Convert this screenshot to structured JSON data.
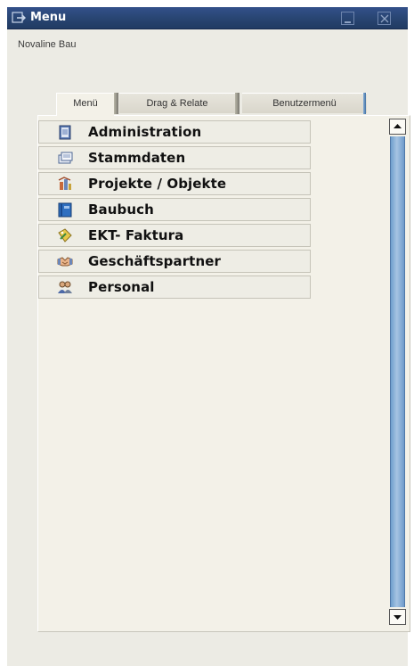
{
  "window": {
    "title": "Menu",
    "company": "Novaline Bau"
  },
  "tabs": [
    {
      "label": "Menü",
      "active": true
    },
    {
      "label": "Drag & Relate",
      "active": false
    },
    {
      "label": "Benutzermenü",
      "active": false
    }
  ],
  "menu": {
    "items": [
      {
        "label": "Administration",
        "icon": "administration-icon"
      },
      {
        "label": "Stammdaten",
        "icon": "stammdaten-icon"
      },
      {
        "label": "Projekte / Objekte",
        "icon": "projekte-icon"
      },
      {
        "label": "Baubuch",
        "icon": "baubuch-icon"
      },
      {
        "label": "EKT- Faktura",
        "icon": "faktura-icon"
      },
      {
        "label": "Geschäftspartner",
        "icon": "geschaeftspartner-icon"
      },
      {
        "label": "Personal",
        "icon": "personal-icon"
      }
    ]
  },
  "colors": {
    "titlebar": "#27436f",
    "panel": "#f3f1e8",
    "scrollbar": "#8fb3d9"
  }
}
